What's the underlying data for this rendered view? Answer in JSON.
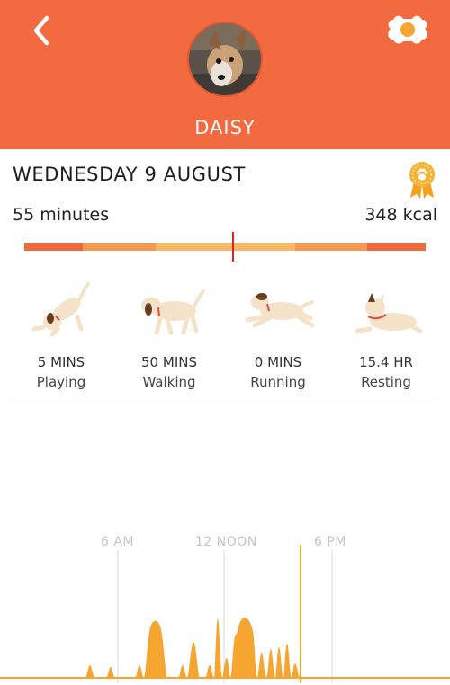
{
  "header": {
    "pet_name": "DAISY",
    "back_icon": "chevron-left-icon",
    "collar_icon": "bone-collar-icon",
    "colors": {
      "background": "#f26a3f"
    }
  },
  "summary": {
    "date": "WEDNESDAY 9 AUGUST",
    "minutes": "55 minutes",
    "kcal": "348 kcal",
    "badge_icon": "paw-award-ribbon-icon",
    "goal_progress": 0.52
  },
  "activities": [
    {
      "value": "5 MINS",
      "label": "Playing",
      "icon": "playing-dog-icon"
    },
    {
      "value": "50 MINS",
      "label": "Walking",
      "icon": "walking-dog-icon"
    },
    {
      "value": "0 MINS",
      "label": "Running",
      "icon": "running-dog-icon"
    },
    {
      "value": "15.4 HR",
      "label": "Resting",
      "icon": "resting-dog-icon"
    }
  ],
  "timeline": {
    "labels": [
      "6 AM",
      "12 NOON",
      "6 PM"
    ],
    "colors": {
      "activity": "#f7a531",
      "gridline": "#d9d9d9"
    }
  }
}
